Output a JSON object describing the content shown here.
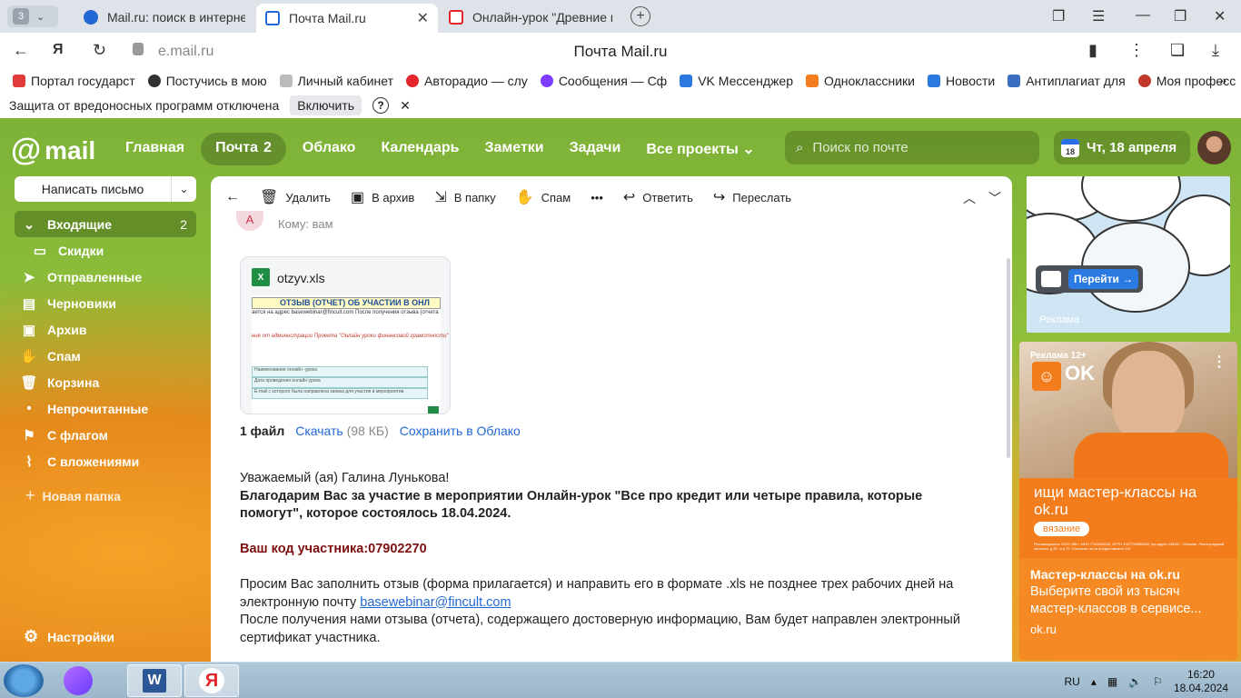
{
  "browser": {
    "tab_count": "3",
    "tabs": [
      {
        "label": "Mail.ru: поиск в интернете",
        "color": "#2168d4"
      },
      {
        "label": "Почта Mail.ru",
        "color": "#2168d4"
      },
      {
        "label": "Онлайн-урок \"Древние м",
        "color": "#e4252b"
      }
    ],
    "url_host": "e.mail.ru",
    "page_title": "Почта Mail.ru",
    "bookmarks": [
      {
        "label": "Портал государст",
        "color": "#e23b3b"
      },
      {
        "label": "Постучись в мою",
        "color": "#333333"
      },
      {
        "label": "Личный кабинет",
        "color": "#999999"
      },
      {
        "label": "Авторадио — слу",
        "color": "#e4252b"
      },
      {
        "label": "Сообщения — Сф",
        "color": "#7d3bff"
      },
      {
        "label": "VK Мессенджер",
        "color": "#2a7ae2"
      },
      {
        "label": "Одноклассники",
        "color": "#f37c1c"
      },
      {
        "label": "Новости",
        "color": "#2a7ae2"
      },
      {
        "label": "Антиплагиат для",
        "color": "#3a6fbf"
      },
      {
        "label": "Моя професс",
        "color": "#c0392b"
      }
    ],
    "protection_text": "Защита от вредоносных программ отключена",
    "protection_button": "Включить",
    "help_symbol": "?",
    "close_symbol": "✕"
  },
  "header": {
    "logo_at": "@",
    "logo_text": "mail",
    "nav": [
      {
        "label": "Главная"
      },
      {
        "label": "Почта",
        "count": "2"
      },
      {
        "label": "Облако"
      },
      {
        "label": "Календарь"
      },
      {
        "label": "Заметки"
      },
      {
        "label": "Задачи"
      },
      {
        "label": "Все проекты"
      }
    ],
    "search_placeholder": "Поиск по почте",
    "calendar_day": "18",
    "date": "Чт, 18 апреля"
  },
  "sidebar": {
    "compose": "Написать письмо",
    "folders": [
      {
        "label": "Входящие",
        "count": "2",
        "icon": "chevron-down-icon"
      },
      {
        "label": "Скидки",
        "icon": "folder-icon"
      },
      {
        "label": "Отправленные",
        "icon": "send-icon"
      },
      {
        "label": "Черновики",
        "icon": "draft-icon"
      },
      {
        "label": "Архив",
        "icon": "archive-icon"
      },
      {
        "label": "Спам",
        "icon": "spam-icon"
      },
      {
        "label": "Корзина",
        "icon": "trash-icon"
      },
      {
        "label": "Непрочитанные",
        "icon": "dot-icon"
      },
      {
        "label": "С флагом",
        "icon": "flag-icon"
      },
      {
        "label": "С вложениями",
        "icon": "paperclip-icon"
      }
    ],
    "new_folder": "Новая папка",
    "settings": "Настройки"
  },
  "toolbar": {
    "delete": "Удалить",
    "archive": "В архив",
    "to_folder": "В папку",
    "spam": "Спам",
    "more": "•••",
    "reply": "Ответить",
    "forward": "Переслать"
  },
  "letter": {
    "sender_initial": "А",
    "to": "Кому: вам",
    "attachment": {
      "filename": "otzyv.xls",
      "preview_title": "ОТЗЫВ (ОТЧЕТ) ОБ УЧАСТИИ В ОНЛ",
      "preview_line1": "ается на адрес basewebinar@fincult.com После получения отзыва (отчета",
      "preview_line2": "ние от администрации Проекта \"Онлайн уроки финансовой грамотности\"",
      "preview_rows": [
        "Наименование онлайн -урока",
        "Дата проведения онлайн урока",
        "E-mail с которого была направлена заявка для участия в мероприятии"
      ],
      "count": "1 файл",
      "download": "Скачать",
      "size": "(98 КБ)",
      "save_cloud": "Сохранить в Облако"
    },
    "greeting": "Уважаемый (ая) Галина Лунькова!",
    "thanks": "Благодарим Вас за участие в мероприятии Онлайн-урок \"Все про кредит или четыре правила, которые помогут\", которое состоялось 18.04.2024.",
    "code": "Ваш код участника:07902270",
    "request": "Просим Вас заполнить отзыв (форма прилагается) и направить его в формате .xls не позднее трех рабочих дней на электронную почту",
    "email": "basewebinar@fincult.com",
    "after": "После получения нами отзыва (отчета), содержащего достоверную информацию, Вам будет направлен электронный сертификат участника."
  },
  "ads": {
    "ad1_button": "Перейти →",
    "ad1_label": "Реклама",
    "ad2_tag": "Реклама 12+",
    "ad2_brand": "OK",
    "ad2_headline": "ищи мастер-классы на ok.ru",
    "ad2_pill": "вязание",
    "ad2_fine": "Рекламодатель ООО «ВК», ИНН 7743001033, ОГРН 1027739850962, юр.адрес 125167, г.Москва, Ленинградский проспект д.39, стр.79. Согласие на гм предоставлено 16+",
    "ad2_title": "Мастер-классы на ok.ru",
    "ad2_desc": "Выберите свой из тысяч мастер-классов в сервисе...",
    "ad2_url": "ok.ru"
  },
  "taskbar": {
    "lang": "RU",
    "time": "16:20",
    "date": "18.04.2024",
    "word": "W",
    "yandex": "Я"
  }
}
